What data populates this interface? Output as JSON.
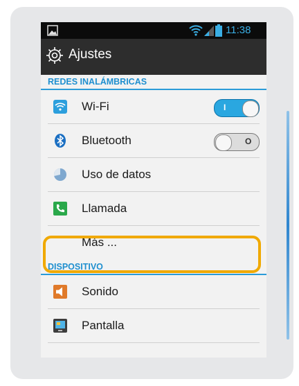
{
  "status_bar": {
    "time": "11:38",
    "icons": [
      "image-icon",
      "wifi-icon",
      "signal-icon",
      "battery-icon"
    ],
    "time_color": "#3aaee4"
  },
  "header": {
    "title": "Ajustes",
    "icon": "gear-icon"
  },
  "sections": [
    {
      "title": "REDES INALÁMBRICAS"
    },
    {
      "title": "DISPOSITIVO"
    }
  ],
  "items": [
    {
      "label": "Wi-Fi",
      "icon": "wifi-icon",
      "toggle": "on",
      "toggle_text": "I"
    },
    {
      "label": "Bluetooth",
      "icon": "bluetooth-icon",
      "toggle": "off",
      "toggle_text": "O"
    },
    {
      "label": "Uso de datos",
      "icon": "data-usage-icon"
    },
    {
      "label": "Llamada",
      "icon": "phone-icon"
    },
    {
      "label": "Más ...",
      "highlighted": true
    },
    {
      "label": "Sonido",
      "icon": "speaker-icon"
    },
    {
      "label": "Pantalla",
      "icon": "display-icon"
    }
  ],
  "colors": {
    "accent": "#2a9bd8",
    "highlight": "#f0a900",
    "toggle_on": "#2aa7e0"
  }
}
